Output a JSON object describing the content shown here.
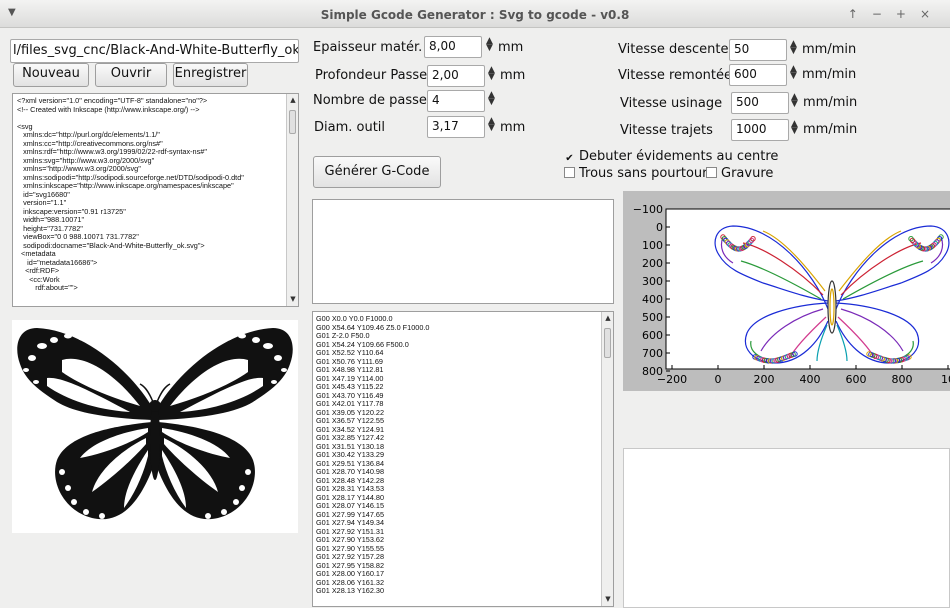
{
  "window": {
    "title": "Simple Gcode Generator : Svg to gcode - v0.8",
    "menu_icon": "triangle-down-icon",
    "controls": [
      "↑",
      "−",
      "+",
      "×"
    ]
  },
  "file": {
    "path": "l/files_svg_cnc/Black-And-White-Butterfly_ok.svg"
  },
  "buttons": {
    "new": "Nouveau",
    "open": "Ouvrir",
    "save": "Enregistrer",
    "generate": "Générer G-Code"
  },
  "params": {
    "thickness": {
      "label": "Epaisseur matér.",
      "value": "8,00",
      "unit": "mm"
    },
    "depth": {
      "label": "Profondeur Passe :",
      "value": "2,00",
      "unit": "mm"
    },
    "passes": {
      "label": "Nombre de passe :",
      "value": "4",
      "unit": ""
    },
    "tool": {
      "label": "Diam. outil",
      "value": "3,17",
      "unit": "mm"
    },
    "speed_down": {
      "label": "Vitesse descente",
      "value": "50",
      "unit": "mm/min"
    },
    "speed_up": {
      "label": "Vitesse remontée",
      "value": "600",
      "unit": "mm/min"
    },
    "speed_mill": {
      "label": "Vitesse usinage",
      "value": "500",
      "unit": "mm/min"
    },
    "speed_travel": {
      "label": "Vitesse trajets",
      "value": "1000",
      "unit": "mm/min"
    }
  },
  "options": {
    "center_start": {
      "label": "Debuter évidements au centre",
      "checked": true
    },
    "no_contour": {
      "label": "Trous sans pourtour",
      "checked": false
    },
    "engrave": {
      "label": "Gravure",
      "checked": false
    }
  },
  "svg_source": [
    "<?xml version=\"1.0\" encoding=\"UTF-8\" standalone=\"no\"?>",
    "<!-- Created with Inkscape (http://www.inkscape.org/) -->",
    "",
    "<svg",
    "   xmlns:dc=\"http://purl.org/dc/elements/1.1/\"",
    "   xmlns:cc=\"http://creativecommons.org/ns#\"",
    "   xmlns:rdf=\"http://www.w3.org/1999/02/22-rdf-syntax-ns#\"",
    "   xmlns:svg=\"http://www.w3.org/2000/svg\"",
    "   xmlns=\"http://www.w3.org/2000/svg\"",
    "   xmlns:sodipodi=\"http://sodipodi.sourceforge.net/DTD/sodipodi-0.dtd\"",
    "   xmlns:inkscape=\"http://www.inkscape.org/namespaces/inkscape\"",
    "   id=\"svg16680\"",
    "   version=\"1.1\"",
    "   inkscape:version=\"0.91 r13725\"",
    "   width=\"988.10071\"",
    "   height=\"731.7782\"",
    "   viewBox=\"0 0 988.10071 731.7782\"",
    "   sodipodi:docname=\"Black-And-White-Butterfly_ok.svg\">",
    "  <metadata",
    "     id=\"metadata16686\">",
    "    <rdf:RDF>",
    "      <cc:Work",
    "         rdf:about=\"\">"
  ],
  "gcode": [
    "G00 X0.0 Y0.0 F1000.0",
    "G00 X54.64 Y109.46 Z5.0 F1000.0",
    "G01 Z-2.0 F50.0",
    "G01 X54.24 Y109.66 F500.0",
    "G01 X52.52 Y110.64",
    "G01 X50.76 Y111.69",
    "G01 X48.98 Y112.81",
    "G01 X47.19 Y114.00",
    "G01 X45.43 Y115.22",
    "G01 X43.70 Y116.49",
    "G01 X42.01 Y117.78",
    "G01 X39.05 Y120.22",
    "G01 X36.57 Y122.55",
    "G01 X34.52 Y124.91",
    "G01 X32.85 Y127.42",
    "G01 X31.51 Y130.18",
    "G01 X30.42 Y133.29",
    "G01 X29.51 Y136.84",
    "G01 X28.70 Y140.98",
    "G01 X28.48 Y142.28",
    "G01 X28.31 Y143.53",
    "G01 X28.17 Y144.80",
    "G01 X28.07 Y146.15",
    "G01 X27.99 Y147.65",
    "G01 X27.94 Y149.34",
    "G01 X27.92 Y151.31",
    "G01 X27.90 Y153.62",
    "G01 X27.90 Y155.55",
    "G01 X27.92 Y157.28",
    "G01 X27.95 Y158.82",
    "G01 X28.00 Y160.17",
    "G01 X28.06 Y161.32",
    "G01 X28.13 Y162.30"
  ],
  "plot": {
    "x_ticks": [
      "−200",
      "0",
      "200",
      "400",
      "600",
      "800",
      "10"
    ],
    "y_ticks": [
      "−100",
      "0",
      "100",
      "200",
      "300",
      "400",
      "500",
      "600",
      "700",
      "800"
    ]
  },
  "icons": {
    "spin": "spinner-arrows-icon",
    "scroll_up": "scroll-up-arrow-icon",
    "scroll_down": "scroll-down-arrow-icon"
  }
}
